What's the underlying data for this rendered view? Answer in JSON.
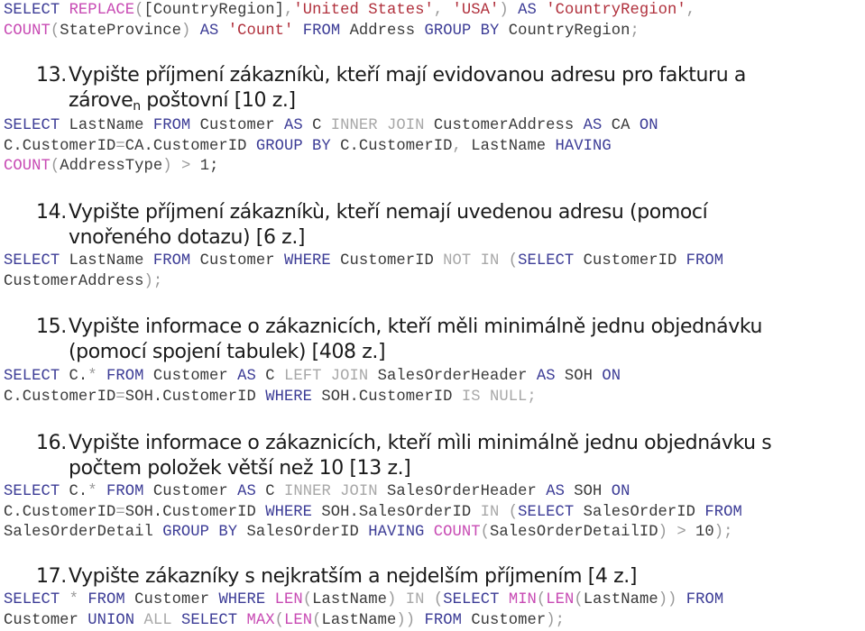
{
  "document": {
    "intro_query": {
      "lines": [
        [
          {
            "t": "SELECT",
            "c": "kw"
          },
          {
            "t": " ",
            "c": "id"
          },
          {
            "t": "REPLACE",
            "c": "fn"
          },
          {
            "t": "(",
            "c": "op"
          },
          {
            "t": "[CountryRegion]",
            "c": "id"
          },
          {
            "t": ",",
            "c": "op"
          },
          {
            "t": "'United States'",
            "c": "str"
          },
          {
            "t": ", ",
            "c": "op"
          },
          {
            "t": "'USA'",
            "c": "str"
          },
          {
            "t": ")",
            "c": "op"
          },
          {
            "t": " ",
            "c": "id"
          },
          {
            "t": "AS",
            "c": "kw"
          },
          {
            "t": " ",
            "c": "id"
          },
          {
            "t": "'CountryRegion'",
            "c": "str"
          },
          {
            "t": ",",
            "c": "op"
          }
        ],
        [
          {
            "t": "COUNT",
            "c": "fn"
          },
          {
            "t": "(",
            "c": "op"
          },
          {
            "t": "StateProvince",
            "c": "id"
          },
          {
            "t": ")",
            "c": "op"
          },
          {
            "t": " ",
            "c": "id"
          },
          {
            "t": "AS",
            "c": "kw"
          },
          {
            "t": " ",
            "c": "id"
          },
          {
            "t": "'Count'",
            "c": "str"
          },
          {
            "t": " ",
            "c": "id"
          },
          {
            "t": "FROM",
            "c": "kw"
          },
          {
            "t": " Address ",
            "c": "id"
          },
          {
            "t": "GROUP BY",
            "c": "kw"
          },
          {
            "t": " CountryRegion",
            "c": "id"
          },
          {
            "t": ";",
            "c": "op"
          }
        ]
      ]
    },
    "tasks": [
      {
        "number": "13.",
        "line1": "Vypište příjmení zákazníkù, kteří mají evidovanou adresu pro fakturu a",
        "line2_main": "zárove",
        "line2_sub": "n",
        "line2_rest": " poštovní [10 z.]",
        "query": [
          [
            {
              "t": "SELECT",
              "c": "kw"
            },
            {
              "t": " LastName ",
              "c": "id"
            },
            {
              "t": "FROM",
              "c": "kw"
            },
            {
              "t": " Customer ",
              "c": "id"
            },
            {
              "t": "AS",
              "c": "kw"
            },
            {
              "t": " C ",
              "c": "id"
            },
            {
              "t": "INNER JOIN",
              "c": "gr"
            },
            {
              "t": " CustomerAddress ",
              "c": "id"
            },
            {
              "t": "AS",
              "c": "kw"
            },
            {
              "t": " CA ",
              "c": "id"
            },
            {
              "t": "ON",
              "c": "kw"
            }
          ],
          [
            {
              "t": "C.CustomerID",
              "c": "id"
            },
            {
              "t": "=",
              "c": "op"
            },
            {
              "t": "CA.CustomerID ",
              "c": "id"
            },
            {
              "t": "GROUP BY",
              "c": "kw"
            },
            {
              "t": " C.CustomerID",
              "c": "id"
            },
            {
              "t": ",",
              "c": "op"
            },
            {
              "t": " LastName ",
              "c": "id"
            },
            {
              "t": "HAVING",
              "c": "kw"
            }
          ],
          [
            {
              "t": "COUNT",
              "c": "fn"
            },
            {
              "t": "(",
              "c": "op"
            },
            {
              "t": "AddressType",
              "c": "id"
            },
            {
              "t": ")",
              "c": "op"
            },
            {
              "t": " ",
              "c": "id"
            },
            {
              "t": ">",
              "c": "op"
            },
            {
              "t": " 1",
              "c": "id"
            },
            {
              "t": ";",
              "c": "id"
            }
          ]
        ]
      },
      {
        "number": "14.",
        "line1": "Vypište příjmení zákazníkù, kteří nemají uvedenou adresu (pomocí",
        "line2": "vnořeného dotazu) [6 z.]",
        "query": [
          [
            {
              "t": "SELECT",
              "c": "kw"
            },
            {
              "t": " LastName ",
              "c": "id"
            },
            {
              "t": "FROM",
              "c": "kw"
            },
            {
              "t": " Customer ",
              "c": "id"
            },
            {
              "t": "WHERE",
              "c": "kw"
            },
            {
              "t": " CustomerID ",
              "c": "id"
            },
            {
              "t": "NOT IN",
              "c": "gr"
            },
            {
              "t": " ",
              "c": "id"
            },
            {
              "t": "(",
              "c": "op"
            },
            {
              "t": "SELECT",
              "c": "kw"
            },
            {
              "t": " CustomerID ",
              "c": "id"
            },
            {
              "t": "FROM",
              "c": "kw"
            }
          ],
          [
            {
              "t": "CustomerAddress",
              "c": "id"
            },
            {
              "t": ");",
              "c": "op"
            }
          ]
        ]
      },
      {
        "number": "15.",
        "line1": "Vypište informace o zákaznicích, kteří měli minimálně jednu objednávku",
        "line2": "(pomocí spojení tabulek) [408 z.]",
        "query": [
          [
            {
              "t": "SELECT",
              "c": "kw"
            },
            {
              "t": " C.",
              "c": "id"
            },
            {
              "t": "*",
              "c": "op"
            },
            {
              "t": " ",
              "c": "id"
            },
            {
              "t": "FROM",
              "c": "kw"
            },
            {
              "t": " Customer ",
              "c": "id"
            },
            {
              "t": "AS",
              "c": "kw"
            },
            {
              "t": " C ",
              "c": "id"
            },
            {
              "t": "LEFT JOIN",
              "c": "gr"
            },
            {
              "t": " SalesOrderHeader ",
              "c": "id"
            },
            {
              "t": "AS",
              "c": "kw"
            },
            {
              "t": " SOH ",
              "c": "id"
            },
            {
              "t": "ON",
              "c": "kw"
            }
          ],
          [
            {
              "t": "C.CustomerID",
              "c": "id"
            },
            {
              "t": "=",
              "c": "op"
            },
            {
              "t": "SOH.CustomerID ",
              "c": "id"
            },
            {
              "t": "WHERE",
              "c": "kw"
            },
            {
              "t": " SOH.CustomerID ",
              "c": "id"
            },
            {
              "t": "IS NULL;",
              "c": "gr"
            }
          ]
        ]
      },
      {
        "number": "16.",
        "line1": "Vypište informace o zákaznicích, kteří mìli minimálně jednu objednávku s",
        "line2": "počtem položek větší než 10 [13 z.]",
        "query": [
          [
            {
              "t": "SELECT",
              "c": "kw"
            },
            {
              "t": " C.",
              "c": "id"
            },
            {
              "t": "*",
              "c": "op"
            },
            {
              "t": " ",
              "c": "id"
            },
            {
              "t": "FROM",
              "c": "kw"
            },
            {
              "t": " Customer ",
              "c": "id"
            },
            {
              "t": "AS",
              "c": "kw"
            },
            {
              "t": " C ",
              "c": "id"
            },
            {
              "t": "INNER JOIN",
              "c": "gr"
            },
            {
              "t": " SalesOrderHeader ",
              "c": "id"
            },
            {
              "t": "AS",
              "c": "kw"
            },
            {
              "t": " SOH ",
              "c": "id"
            },
            {
              "t": "ON",
              "c": "kw"
            }
          ],
          [
            {
              "t": "C.CustomerID",
              "c": "id"
            },
            {
              "t": "=",
              "c": "op"
            },
            {
              "t": "SOH.CustomerID ",
              "c": "id"
            },
            {
              "t": "WHERE",
              "c": "kw"
            },
            {
              "t": " SOH.SalesOrderID ",
              "c": "id"
            },
            {
              "t": "IN",
              "c": "gr"
            },
            {
              "t": " ",
              "c": "id"
            },
            {
              "t": "(",
              "c": "op"
            },
            {
              "t": "SELECT",
              "c": "kw"
            },
            {
              "t": " SalesOrderID ",
              "c": "id"
            },
            {
              "t": "FROM",
              "c": "kw"
            }
          ],
          [
            {
              "t": "SalesOrderDetail ",
              "c": "id"
            },
            {
              "t": "GROUP BY",
              "c": "kw"
            },
            {
              "t": " SalesOrderID ",
              "c": "id"
            },
            {
              "t": "HAVING",
              "c": "kw"
            },
            {
              "t": " ",
              "c": "id"
            },
            {
              "t": "COUNT",
              "c": "fn"
            },
            {
              "t": "(",
              "c": "op"
            },
            {
              "t": "SalesOrderDetailID",
              "c": "id"
            },
            {
              "t": ")",
              "c": "op"
            },
            {
              "t": " ",
              "c": "id"
            },
            {
              "t": ">",
              "c": "op"
            },
            {
              "t": " 10",
              "c": "id"
            },
            {
              "t": ");",
              "c": "op"
            }
          ]
        ]
      },
      {
        "number": "17.",
        "line1": "Vypište zákazníky s nejkratším a nejdelším příjmením [4 z.]",
        "query": [
          [
            {
              "t": "SELECT",
              "c": "kw"
            },
            {
              "t": " ",
              "c": "id"
            },
            {
              "t": "*",
              "c": "op"
            },
            {
              "t": " ",
              "c": "id"
            },
            {
              "t": "FROM",
              "c": "kw"
            },
            {
              "t": " Customer ",
              "c": "id"
            },
            {
              "t": "WHERE",
              "c": "kw"
            },
            {
              "t": " ",
              "c": "id"
            },
            {
              "t": "LEN",
              "c": "fn"
            },
            {
              "t": "(",
              "c": "op"
            },
            {
              "t": "LastName",
              "c": "id"
            },
            {
              "t": ")",
              "c": "op"
            },
            {
              "t": " ",
              "c": "id"
            },
            {
              "t": "IN",
              "c": "gr"
            },
            {
              "t": " ",
              "c": "id"
            },
            {
              "t": "(",
              "c": "op"
            },
            {
              "t": "SELECT",
              "c": "kw"
            },
            {
              "t": " ",
              "c": "id"
            },
            {
              "t": "MIN",
              "c": "fn"
            },
            {
              "t": "(",
              "c": "op"
            },
            {
              "t": "LEN",
              "c": "fn"
            },
            {
              "t": "(",
              "c": "op"
            },
            {
              "t": "LastName",
              "c": "id"
            },
            {
              "t": "))",
              "c": "op"
            },
            {
              "t": " ",
              "c": "id"
            },
            {
              "t": "FROM",
              "c": "kw"
            }
          ],
          [
            {
              "t": "Customer ",
              "c": "id"
            },
            {
              "t": "UNION",
              "c": "kw"
            },
            {
              "t": " ",
              "c": "id"
            },
            {
              "t": "ALL",
              "c": "gr"
            },
            {
              "t": " ",
              "c": "id"
            },
            {
              "t": "SELECT",
              "c": "kw"
            },
            {
              "t": " ",
              "c": "id"
            },
            {
              "t": "MAX",
              "c": "fn"
            },
            {
              "t": "(",
              "c": "op"
            },
            {
              "t": "LEN",
              "c": "fn"
            },
            {
              "t": "(",
              "c": "op"
            },
            {
              "t": "LastName",
              "c": "id"
            },
            {
              "t": "))",
              "c": "op"
            },
            {
              "t": " ",
              "c": "id"
            },
            {
              "t": "FROM",
              "c": "kw"
            },
            {
              "t": " Customer",
              "c": "id"
            },
            {
              "t": ");",
              "c": "op"
            }
          ]
        ]
      }
    ]
  },
  "colors": {
    "keyword": "#3c3c96",
    "function": "#c84bb4",
    "string": "#b0303c",
    "operator": "#9a9a9a",
    "gray_keyword": "#a8a8a8",
    "identifier": "#3a3a3a",
    "heading": "#1a1a1a"
  }
}
